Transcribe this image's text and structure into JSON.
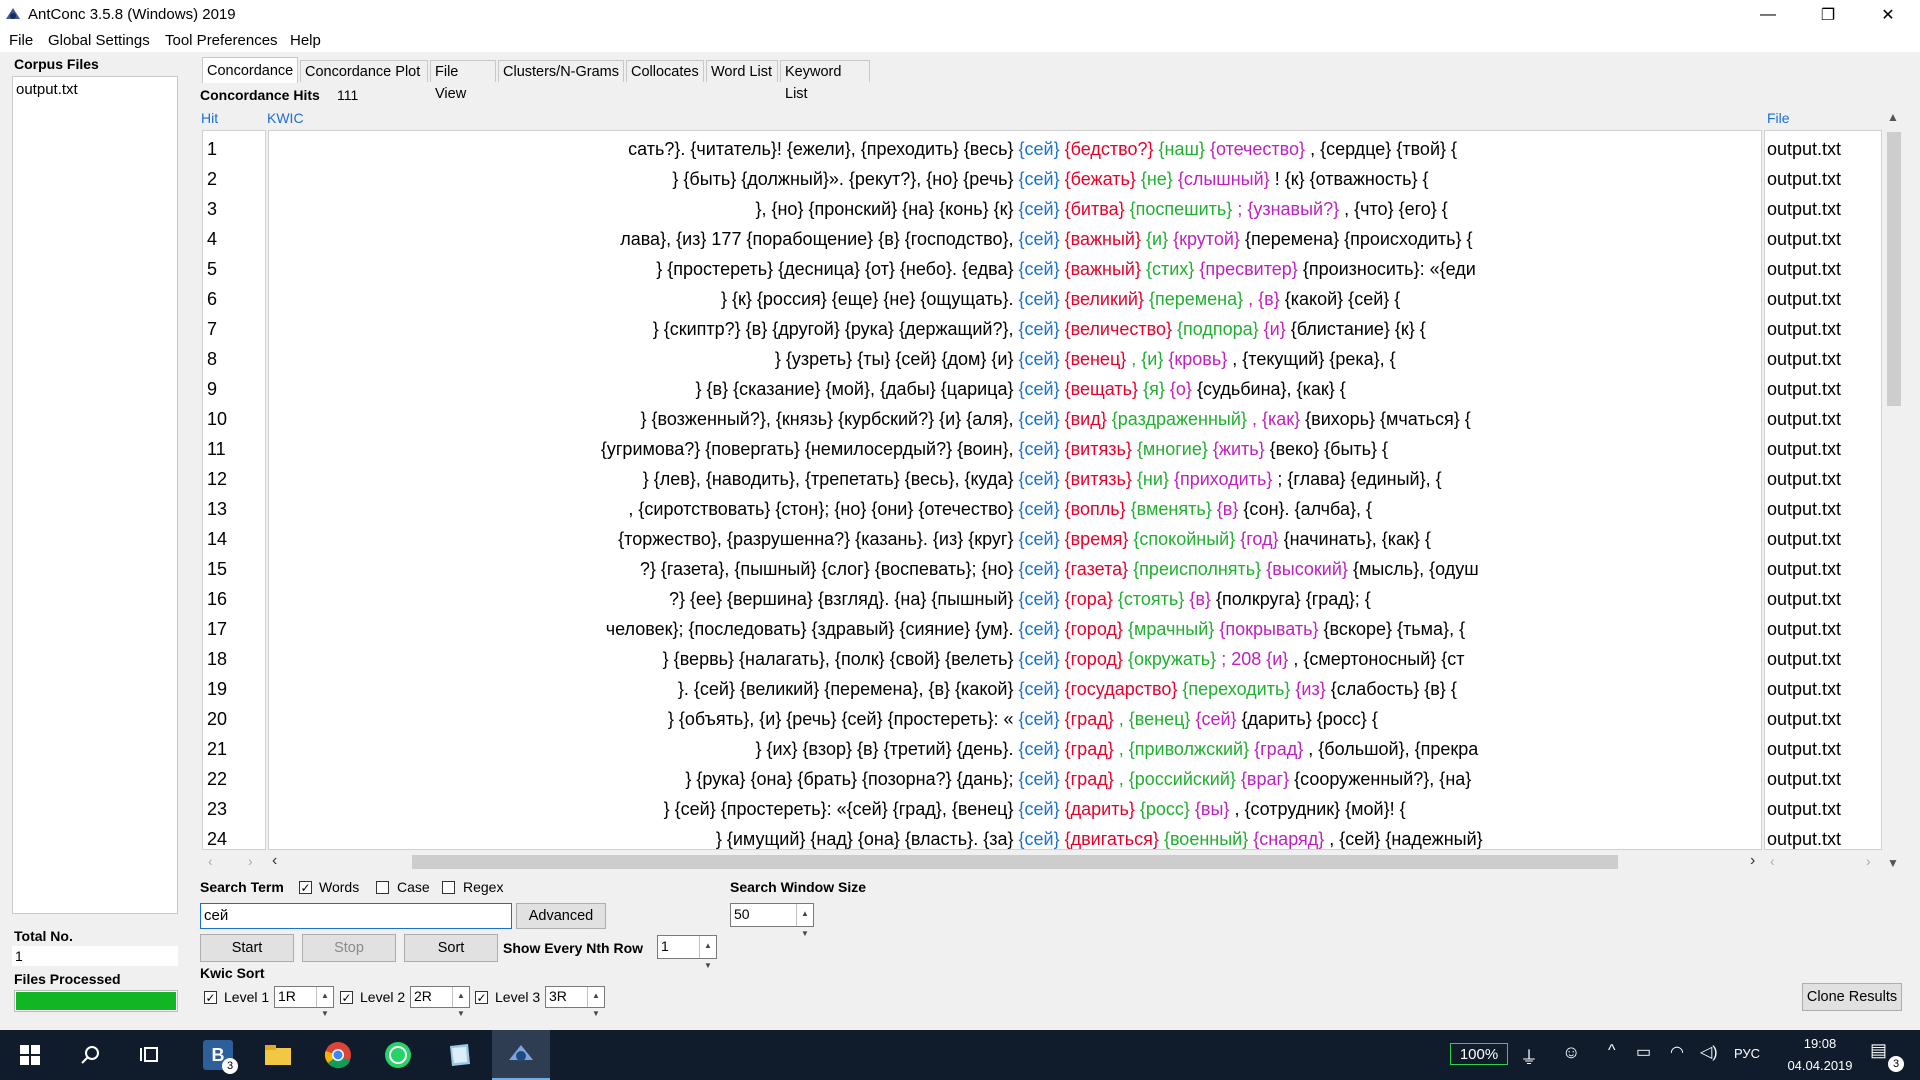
{
  "window": {
    "title": "AntConc 3.5.8 (Windows) 2019",
    "controls": {
      "minimize": "—",
      "restore": "❐",
      "close": "✕"
    }
  },
  "menu": [
    "File",
    "Global Settings",
    "Tool Preferences",
    "Help"
  ],
  "sidebar": {
    "corpus_files_label": "Corpus Files",
    "files": [
      "output.txt"
    ],
    "total_no_label": "Total No.",
    "total_no_value": "1",
    "files_processed_label": "Files Processed",
    "progress": 1.0,
    "progress_color": "#12b523"
  },
  "tabs": [
    {
      "label": "Concordance",
      "active": true
    },
    {
      "label": "Concordance Plot",
      "active": false
    },
    {
      "label": "File View",
      "active": false
    },
    {
      "label": "Clusters/N-Grams",
      "active": false
    },
    {
      "label": "Collocates",
      "active": false
    },
    {
      "label": "Word List",
      "active": false
    },
    {
      "label": "Keyword List",
      "active": false
    }
  ],
  "concordance": {
    "hits_label": "Concordance Hits",
    "hits_value": "111",
    "col_hit": "Hit",
    "col_kwic": "KWIC",
    "col_file": "File",
    "rows": [
      {
        "hit": "1",
        "left": "сать?}. {читатель}! {ежели}, {преходить} {весь}",
        "kw": "{сей}",
        "r1": "{бедство?}",
        "r2": "{наш}",
        "r3": "{отечество}",
        "rest": ", {сердце} {твой} {",
        "file": "output.txt"
      },
      {
        "hit": "2",
        "left": "} {быть} {должный}». {рекут?}, {но} {речь}",
        "kw": "{сей}",
        "r1": "{бежать}",
        "r2": "{не}",
        "r3": "{слышный}",
        "rest": "! {к} {отважность} {",
        "file": "output.txt"
      },
      {
        "hit": "3",
        "left": "}, {но} {пронский} {на} {конь} {к}",
        "kw": "{сей}",
        "r1": "{битва}",
        "r2": "{поспешить}",
        "r3": "; {узнавый?}",
        "rest": ", {что} {его} {",
        "file": "output.txt"
      },
      {
        "hit": "4",
        "left": "лава}, {из} 177 {порабощение} {в} {господство},",
        "kw": "{сей}",
        "r1": "{важный}",
        "r2": "{и}",
        "r3": "{крутой}",
        "rest": " {перемена} {происходить} {",
        "file": "output.txt"
      },
      {
        "hit": "5",
        "left": "} {простереть} {десница} {от} {небо}. {едва}",
        "kw": "{сей}",
        "r1": "{важный}",
        "r2": "{стих}",
        "r3": "{пресвитер}",
        "rest": " {произносить}: «{еди",
        "file": "output.txt"
      },
      {
        "hit": "6",
        "left": "} {к} {россия} {еще} {не} {ощущать}.",
        "kw": "{сей}",
        "r1": "{великий}",
        "r2": "{перемена}",
        "r3": ", {в}",
        "rest": " {какой} {сей} {",
        "file": "output.txt"
      },
      {
        "hit": "7",
        "left": "} {скиптр?} {в} {другой} {рука} {держащий?},",
        "kw": "{сей}",
        "r1": "{величество}",
        "r2": "{подпора}",
        "r3": "{и}",
        "rest": " {блистание} {к} {",
        "file": "output.txt"
      },
      {
        "hit": "8",
        "left": "} {узреть} {ты} {сей} {дом} {и}",
        "kw": "{сей}",
        "r1": "{венец}",
        "r2": ", {и}",
        "r3": "{кровь}",
        "rest": ", {текущий} {река}, {",
        "file": "output.txt"
      },
      {
        "hit": "9",
        "left": "} {в} {сказание} {мой}, {дабы} {царица}",
        "kw": "{сей}",
        "r1": "{вещать}",
        "r2": "{я}",
        "r3": "{о}",
        "rest": " {судьбина}, {как} {",
        "file": "output.txt"
      },
      {
        "hit": "10",
        "left": "} {возженный?}, {князь} {курбский?} {и} {аля},",
        "kw": "{сей}",
        "r1": "{вид}",
        "r2": "{раздраженный}",
        "r3": ", {как}",
        "rest": " {вихорь} {мчаться} {",
        "file": "output.txt"
      },
      {
        "hit": "11",
        "left": "{угримова?} {повергать} {немилосердый?} {воин},",
        "kw": "{сей}",
        "r1": "{витязь}",
        "r2": "{многие}",
        "r3": "{жить}",
        "rest": " {веко} {быть} {",
        "file": "output.txt"
      },
      {
        "hit": "12",
        "left": "} {лев}, {наводить}, {трепетать} {весь}, {куда}",
        "kw": "{сей}",
        "r1": "{витязь}",
        "r2": "{ни}",
        "r3": "{приходить}",
        "rest": "; {глава} {единый}, {",
        "file": "output.txt"
      },
      {
        "hit": "13",
        "left": ", {сиротствовать} {стон}; {но} {они} {отечество}",
        "kw": "{сей}",
        "r1": "{вопль}",
        "r2": "{вменять}",
        "r3": "{в}",
        "rest": " {сон}. {алчба}, {",
        "file": "output.txt"
      },
      {
        "hit": "14",
        "left": "{торжество}, {разрушенна?} {казань}. {из} {круг}",
        "kw": "{сей}",
        "r1": "{время}",
        "r2": "{спокойный}",
        "r3": "{год}",
        "rest": " {начинать}, {как} {",
        "file": "output.txt"
      },
      {
        "hit": "15",
        "left": "?} {газета}, {пышный} {слог} {воспевать}; {но}",
        "kw": "{сей}",
        "r1": "{газета}",
        "r2": "{преисполнять}",
        "r3": "{высокий}",
        "rest": " {мысль}, {одуш",
        "file": "output.txt"
      },
      {
        "hit": "16",
        "left": "?} {ее} {вершина} {взгляд}. {на} {пышный}",
        "kw": "{сей}",
        "r1": "{гора}",
        "r2": "{стоять}",
        "r3": "{в}",
        "rest": " {полкруга} {град}; {",
        "file": "output.txt"
      },
      {
        "hit": "17",
        "left": "человек}; {последовать} {здравый} {сияние} {ум}.",
        "kw": "{сей}",
        "r1": "{город}",
        "r2": "{мрачный}",
        "r3": "{покрывать}",
        "rest": " {вскоре} {тьма}, {",
        "file": "output.txt"
      },
      {
        "hit": "18",
        "left": "} {вервь} {налагать}, {полк} {свой} {велеть}",
        "kw": "{сей}",
        "r1": "{город}",
        "r2": "{окружать}",
        "r3": "; 208 {и}",
        "rest": ", {смертоносный} {ст",
        "file": "output.txt"
      },
      {
        "hit": "19",
        "left": "}. {сей} {великий} {перемена}, {в} {какой}",
        "kw": "{сей}",
        "r1": "{государство}",
        "r2": "{переходить}",
        "r3": "{из}",
        "rest": " {слабость} {в} {",
        "file": "output.txt"
      },
      {
        "hit": "20",
        "left": "} {объять}, {и} {речь} {сей} {простереть}: «",
        "kw": "{сей}",
        "r1": "{град}",
        "r2": ", {венец}",
        "r3": "{сей}",
        "rest": " {дарить} {росс} {",
        "file": "output.txt"
      },
      {
        "hit": "21",
        "left": "} {их} {взор} {в} {третий} {день}.",
        "kw": "{сей}",
        "r1": "{град}",
        "r2": ", {приволжский}",
        "r3": "{град}",
        "rest": ", {большой}, {прекра",
        "file": "output.txt"
      },
      {
        "hit": "22",
        "left": "} {рука} {она} {брать} {позорна?} {дань};",
        "kw": "{сей}",
        "r1": "{град}",
        "r2": ", {российский}",
        "r3": "{враг}",
        "rest": " {сооруженный?}, {на}",
        "file": "output.txt"
      },
      {
        "hit": "23",
        "left": "} {сей} {простереть}: «{сей} {град}, {венец}",
        "kw": "{сей}",
        "r1": "{дарить}",
        "r2": "{росс}",
        "r3": "{вы}",
        "rest": ", {сотрудник} {мой}! {",
        "file": "output.txt"
      },
      {
        "hit": "24",
        "left": "} {имущий} {над} {она} {власть}. {за}",
        "kw": "{сей}",
        "r1": "{двигаться}",
        "r2": "{военный}",
        "r3": "{снаряд}",
        "rest": ", {сей} {надежный}",
        "file": "output.txt"
      }
    ]
  },
  "search": {
    "term_label": "Search Term",
    "words_label": "Words",
    "words_checked": true,
    "case_label": "Case",
    "case_checked": false,
    "regex_label": "Regex",
    "regex_checked": false,
    "value": "сей",
    "advanced_label": "Advanced",
    "window_size_label": "Search Window Size",
    "window_size_value": "50",
    "start_label": "Start",
    "stop_label": "Stop",
    "sort_label": "Sort",
    "nth_row_label": "Show Every Nth Row",
    "nth_row_value": "1"
  },
  "kwic_sort": {
    "label": "Kwic Sort",
    "levels": [
      {
        "label": "Level 1",
        "value": "1R",
        "checked": true
      },
      {
        "label": "Level 2",
        "value": "2R",
        "checked": true
      },
      {
        "label": "Level 3",
        "value": "3R",
        "checked": true
      }
    ],
    "clone_label": "Clone Results"
  },
  "colors": {
    "kw": "#1a6fd8",
    "r1": "#e8002a",
    "r2": "#20b030",
    "r3": "#c020c0"
  },
  "taskbar": {
    "battery": "100%",
    "lang": "РУС",
    "time": "19:08",
    "date": "04.04.2019",
    "notifications": "3",
    "app_badge": "3"
  }
}
